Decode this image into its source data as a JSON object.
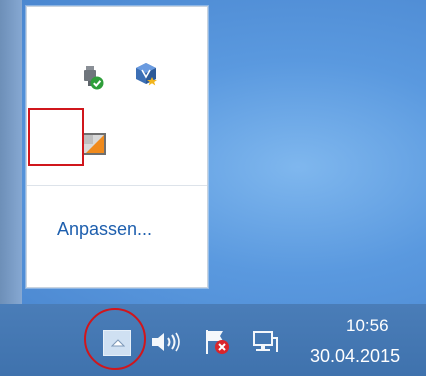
{
  "flyout": {
    "customize_label": "Anpassen...",
    "icons": [
      "usb-device-icon",
      "virtualbox-icon",
      "app-tray-icon"
    ]
  },
  "taskbar": {
    "show_hidden_icons": "chevron-up-icon",
    "icons": [
      "volume-icon",
      "action-center-flag-icon",
      "network-icon"
    ],
    "clock": {
      "time": "10:56",
      "date": "30.04.2015"
    }
  },
  "colors": {
    "highlight": "#d0161c",
    "link": "#1e5fae",
    "taskbar": "#4477b2"
  }
}
